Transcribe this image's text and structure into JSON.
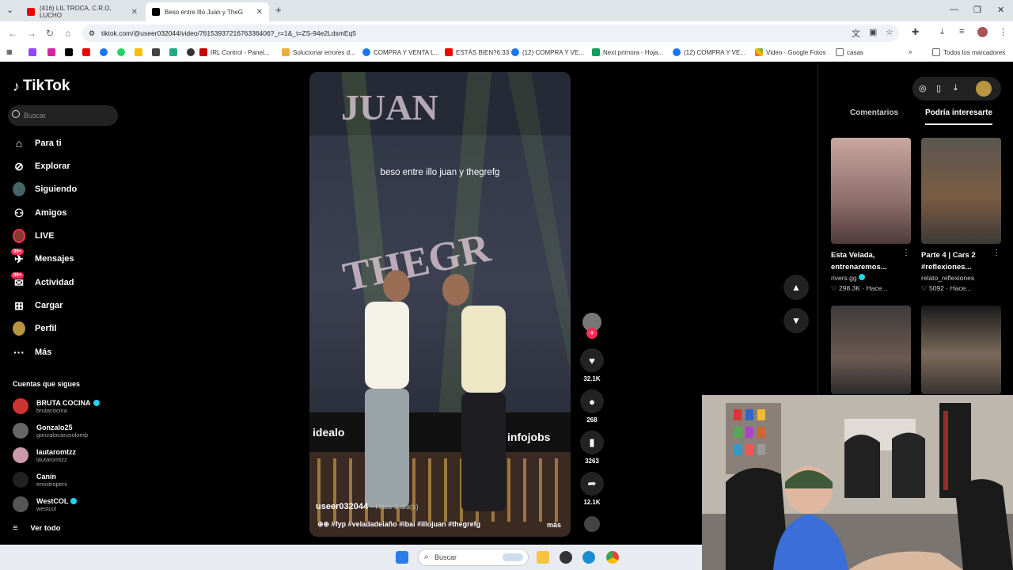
{
  "browser": {
    "tabs": [
      {
        "label": "(416) LIL TROCA, C.R.O, LUCHO",
        "active": false
      },
      {
        "label": "Beso entre Illo Juan y TheG",
        "active": true
      }
    ],
    "new_tab": "+",
    "url": "tiktok.com/@useer032044/video/7615393721676336406?_r=1&_t=ZS-94e2LdsmEq5",
    "bookmarks": [
      "IRL Control - Panel...",
      "Solucionar errores d...",
      "COMPRA Y VENTA L...",
      "ESTÁS BIEN?6:33",
      "(12) COMPRA Y VE...",
      "Next primora - Hoja...",
      "(12) COMPRA Y VE...",
      "Video - Google Fotos",
      "casas"
    ],
    "all_bookmarks": "Todos los marcadores"
  },
  "sidebar": {
    "logo": "TikTok",
    "search_placeholder": "Buscar",
    "nav": [
      {
        "label": "Para ti",
        "icon": "home-icon"
      },
      {
        "label": "Explorar",
        "icon": "compass-icon"
      },
      {
        "label": "Siguiendo",
        "icon": "following-icon"
      },
      {
        "label": "Amigos",
        "icon": "friends-icon"
      },
      {
        "label": "LIVE",
        "icon": "live-icon"
      },
      {
        "label": "Mensajes",
        "icon": "messages-icon",
        "badge": "99+"
      },
      {
        "label": "Actividad",
        "icon": "activity-icon",
        "badge": "99+"
      },
      {
        "label": "Cargar",
        "icon": "upload-icon"
      },
      {
        "label": "Perfil",
        "icon": "profile-icon"
      },
      {
        "label": "Más",
        "icon": "more-icon"
      }
    ],
    "following_title": "Cuentas que sigues",
    "following": [
      {
        "name": "BRUTA COCINA",
        "user": "brutacocina",
        "verified": true
      },
      {
        "name": "Gonzalo25",
        "user": "gonzalocarusolomb",
        "verified": false
      },
      {
        "name": "lautaromtzz",
        "user": "lautaromtzz",
        "verified": false
      },
      {
        "name": "Canin",
        "user": "emistropeni",
        "verified": false
      },
      {
        "name": "WestCOL",
        "user": "westcol",
        "verified": true
      }
    ],
    "see_all": "Ver todo"
  },
  "video": {
    "caption": "beso entre illo juan y thegrefg",
    "username": "useer032044",
    "time": "· Hace 3 día(s)",
    "tags": "#fyp #veladadelaño #ibai #illojuan #thegrefg",
    "more": "más"
  },
  "actions": {
    "likes": "32.1K",
    "comments": "268",
    "saves": "3263",
    "shares": "12.1K"
  },
  "right_panel": {
    "tabs": [
      "Comentarios",
      "Podría interesarte"
    ],
    "active_tab": "Podría interesarte",
    "cards": [
      {
        "title": "Esta Velada, entrenaremos...",
        "user": "rivers.gg",
        "verified": true,
        "stats": "298.3K",
        "time": "Hace..."
      },
      {
        "title": "Parte 4 | Cars 2 #reflexiones...",
        "user": "relato_reflexiones",
        "verified": false,
        "stats": "5092",
        "time": "Hace..."
      }
    ]
  },
  "taskbar": {
    "search_placeholder": "Buscar"
  },
  "colors": {
    "accent": "#fe2c55",
    "verified": "#20d5ec"
  }
}
